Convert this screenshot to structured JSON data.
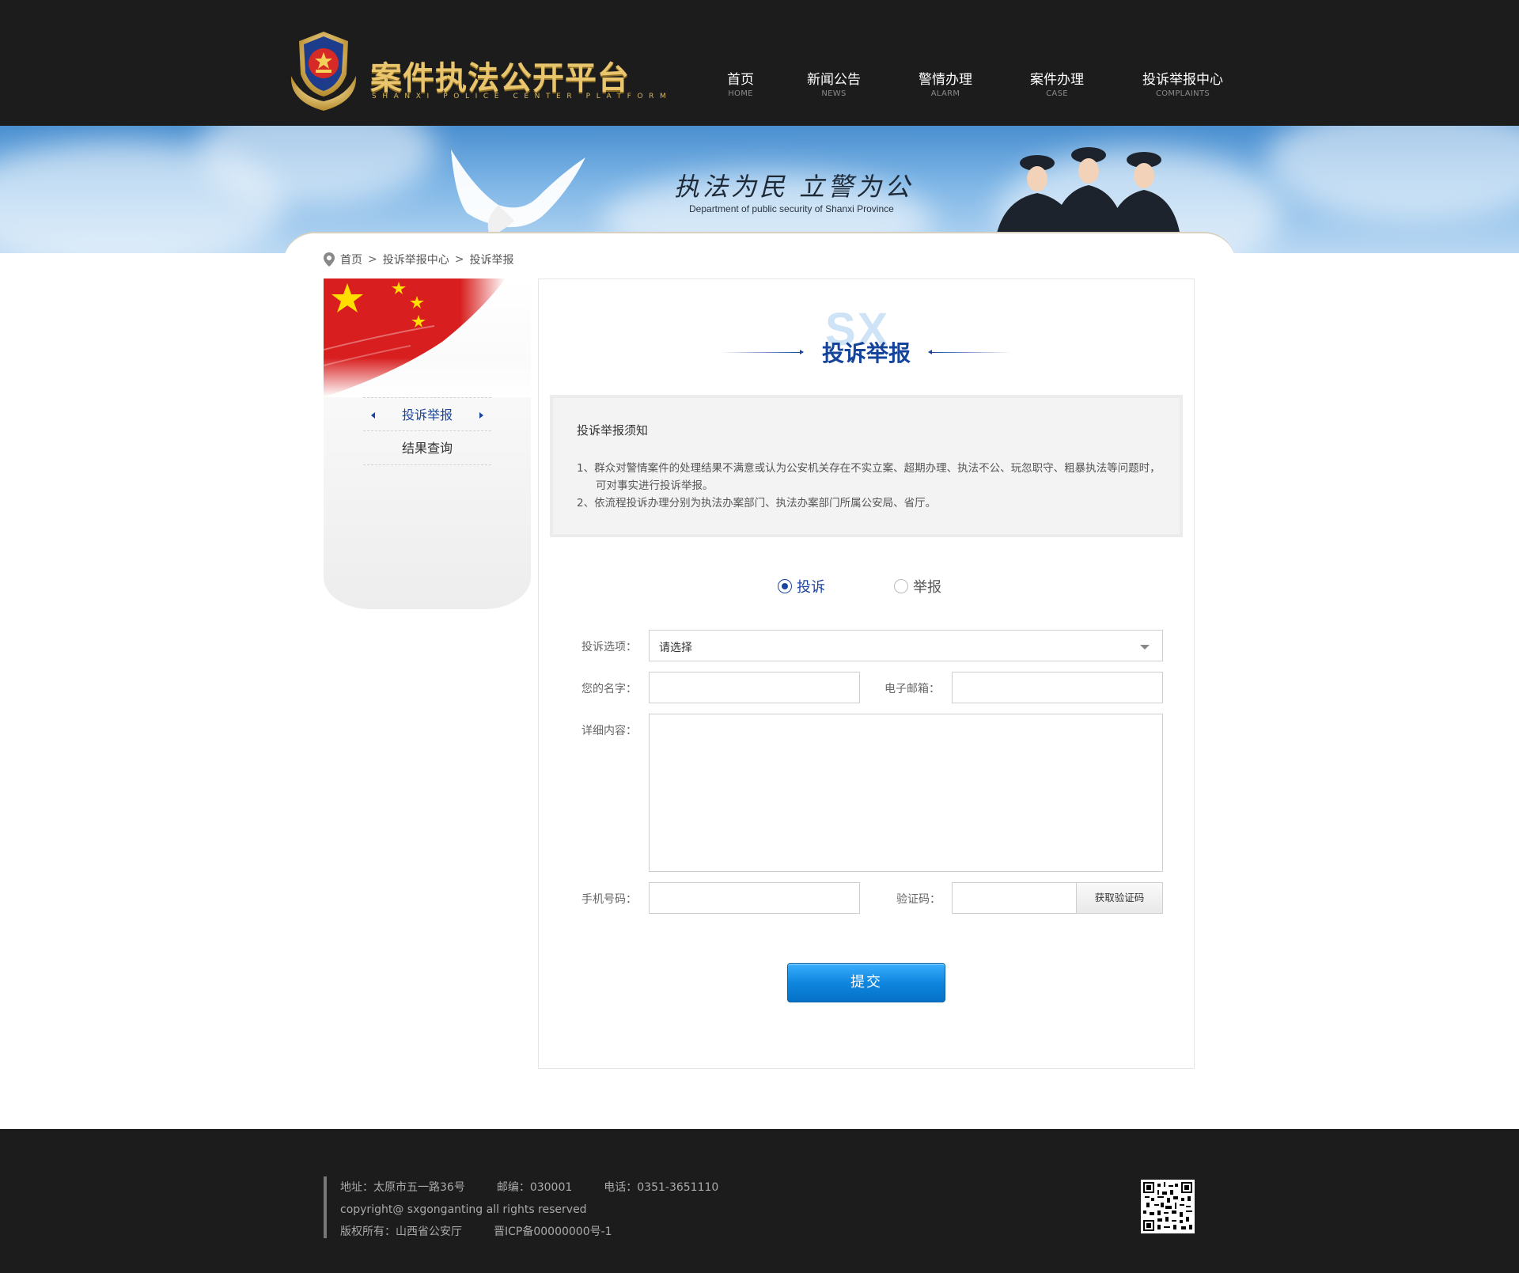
{
  "header": {
    "logo_title": "案件执法公开平台",
    "logo_subtitle": "SHANXI POLICE CENTER PLATFORM",
    "nav": [
      {
        "label": "首页",
        "sub": "HOME"
      },
      {
        "label": "新闻公告",
        "sub": "NEWS"
      },
      {
        "label": "警情办理",
        "sub": "ALARM"
      },
      {
        "label": "案件办理",
        "sub": "CASE"
      },
      {
        "label": "投诉举报中心",
        "sub": "COMPLAINTS"
      }
    ]
  },
  "banner": {
    "slogan": "执法为民 立警为公",
    "slogan_en": "Department of public security of Shanxi Province"
  },
  "breadcrumb": {
    "items": [
      "首页",
      "投诉举报中心",
      "投诉举报"
    ],
    "separator": ">"
  },
  "sidebar": {
    "items": [
      {
        "label": "投诉举报",
        "active": true
      },
      {
        "label": "结果查询",
        "active": false
      }
    ]
  },
  "main": {
    "watermark": "SX",
    "title": "投诉举报",
    "notice": {
      "title": "投诉举报须知",
      "items": [
        "1、群众对警情案件的处理结果不满意或认为公安机关存在不实立案、超期办理、执法不公、玩忽职守、粗暴执法等问题时，可对事实进行投诉举报。",
        "2、依流程投诉办理分别为执法办案部门、执法办案部门所属公安局、省厅。"
      ]
    },
    "report_type": {
      "options": [
        "投诉",
        "举报"
      ],
      "selected": "投诉"
    },
    "form": {
      "option_label": "投诉选项：",
      "option_value": "请选择",
      "name_label": "您的名字：",
      "name_value": "",
      "email_label": "电子邮箱：",
      "email_value": "",
      "detail_label": "详细内容：",
      "detail_value": "",
      "phone_label": "手机号码：",
      "phone_value": "",
      "code_label": "验证码：",
      "code_value": "",
      "code_button": "获取验证码",
      "submit": "提交"
    }
  },
  "footer": {
    "address": "地址：太原市五一路36号",
    "postcode": "邮编：030001",
    "phone": "电话：0351-3651110",
    "copyright": "copyright@ sxgonganting all rights reserved",
    "owner": "版权所有：山西省公安厅",
    "icp": "晋ICP备00000000号-1"
  },
  "colors": {
    "header_bg": "#1c1c1c",
    "accent_blue": "#1b46a0",
    "logo_gold": "#e9c66e",
    "button_blue": "#0f86df"
  }
}
